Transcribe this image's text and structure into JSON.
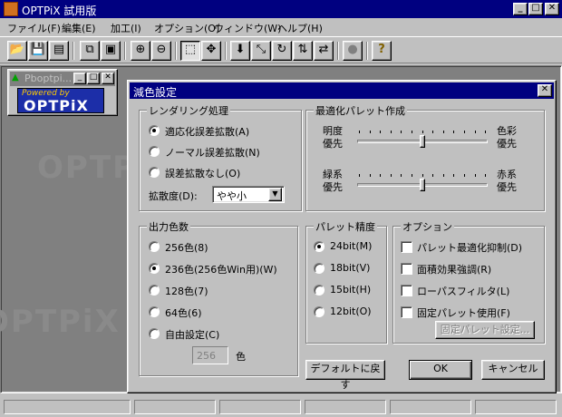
{
  "app": {
    "title": "OPTPiX 試用版"
  },
  "menu": [
    "ファイル(F)",
    "編集(E)",
    "加工(I)",
    "オプション(O)",
    "ウィンドウ(W)",
    "ヘルプ(H)"
  ],
  "toolbar_icons": [
    "open-icon",
    "save-icon",
    "save-all-icon",
    "copy-icon",
    "paste-icon",
    "zoom-in-icon",
    "zoom-out-icon",
    "select-rect-icon",
    "crosshair-icon",
    "reduce-color-icon",
    "resize-icon",
    "rotate-icon",
    "flip-icon",
    "swap-icon",
    "disabled-circle-icon",
    "help-icon"
  ],
  "child_window": {
    "title": "Pboptpi...",
    "banner_line1": "Powered by",
    "banner_line2": "OPTPiX"
  },
  "watermark": "OPTPiX",
  "dialog": {
    "title": "減色設定",
    "rendering": {
      "title": "レンダリング処理",
      "options": [
        "適応化誤差拡散(A)",
        "ノーマル誤差拡散(N)",
        "誤差拡散なし(O)"
      ],
      "selected": 0,
      "diffusion_label": "拡散度(D):",
      "diffusion_value": "やや小"
    },
    "palette_opt": {
      "title": "最適化パレット作成",
      "slider1": {
        "left": "明度\n優先",
        "right": "色彩\n優先",
        "left1": "明度",
        "left2": "優先",
        "right1": "色彩",
        "right2": "優先",
        "value": 0.5
      },
      "slider2": {
        "left1": "緑系",
        "left2": "優先",
        "right1": "赤系",
        "right2": "優先",
        "value": 0.5
      }
    },
    "output_colors": {
      "title": "出力色数",
      "options": [
        "256色(8)",
        "236色(256色Win用)(W)",
        "128色(7)",
        "64色(6)",
        "自由設定(C)"
      ],
      "selected": 1,
      "custom_value": "256",
      "custom_unit": "色"
    },
    "palette_precision": {
      "title": "パレット精度",
      "options": [
        "24bit(M)",
        "18bit(V)",
        "15bit(H)",
        "12bit(O)"
      ],
      "selected": 0
    },
    "options": {
      "title": "オプション",
      "checks": [
        "パレット最適化抑制(D)",
        "面積効果強調(R)",
        "ローパスフィルタ(L)",
        "固定パレット使用(F)"
      ],
      "fixed_palette_button": "固定パレット設定..."
    },
    "buttons": {
      "default": "デフォルトに戻す",
      "ok": "OK",
      "cancel": "キャンセル"
    }
  }
}
